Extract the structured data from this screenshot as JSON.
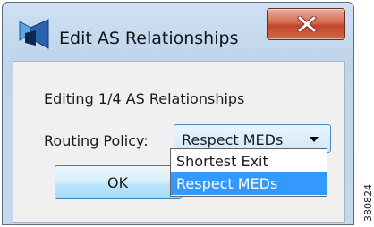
{
  "window": {
    "title": "Edit AS Relationships",
    "app_icon": "network-topology-icon",
    "close_icon": "close-x-icon"
  },
  "dialog": {
    "editing_text": "Editing 1/4 AS Relationships",
    "policy_label": "Routing Policy:",
    "policy_select": {
      "value": "Respect MEDs",
      "arrow_icon": "dropdown-arrow-icon",
      "options": [
        "Shortest Exit",
        "Respect MEDs"
      ],
      "highlighted": "Respect MEDs"
    },
    "ok_label": "OK"
  },
  "figure_number": "380824",
  "colors": {
    "title_bar": "#c6d8ee",
    "close_button": "#c2462b",
    "select_border": "#4f88c8",
    "highlight": "#3399ff"
  }
}
